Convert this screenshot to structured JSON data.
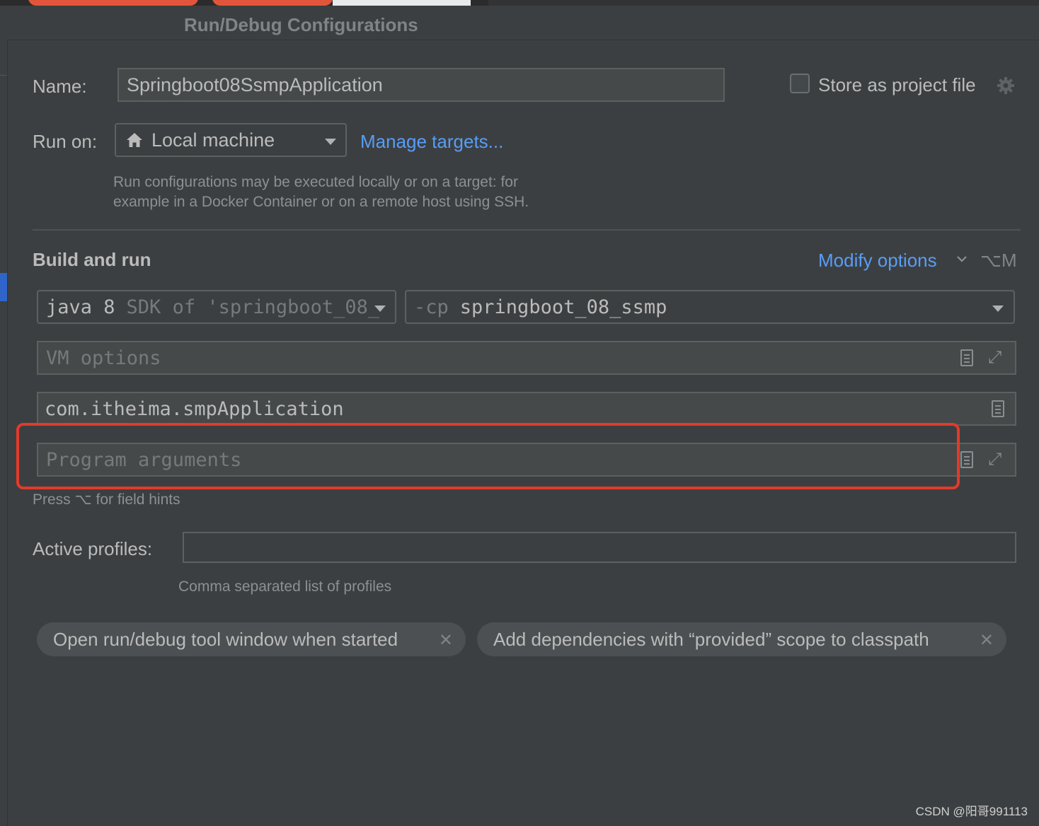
{
  "dialog": {
    "title": "Run/Debug Configurations"
  },
  "name_row": {
    "label": "Name:",
    "value": "Springboot08SsmpApplication",
    "store_checkbox_label": "Store as project file",
    "store_checked": false
  },
  "run_on": {
    "label": "Run on:",
    "target": "Local machine",
    "manage_link": "Manage targets...",
    "hint_line1": "Run configurations may be executed locally or on a target: for",
    "hint_line2": "example in a Docker Container or on a remote host using SSH."
  },
  "build": {
    "section_title": "Build and run",
    "modify_options": "Modify options",
    "modify_shortcut": "⌥M",
    "jdk_name": "java 8",
    "jdk_detail": "SDK of 'springboot_08_",
    "cp_prefix": "-cp",
    "cp_value": "springboot_08_ssmp",
    "vm_options_placeholder": "VM options",
    "main_class": "com.itheima.smpApplication",
    "program_args_placeholder": "Program arguments",
    "field_hints": "Press ⌥ for field hints"
  },
  "profiles": {
    "label": "Active profiles:",
    "value": "",
    "hint": "Comma separated list of profiles"
  },
  "options": [
    {
      "label": "Open run/debug tool window when started"
    },
    {
      "label": "Add dependencies with “provided” scope to classpath"
    }
  ],
  "watermark": "CSDN @阳哥991113",
  "colors": {
    "background": "#3c3f41",
    "link": "#589df6",
    "highlight": "#e23a2b"
  }
}
